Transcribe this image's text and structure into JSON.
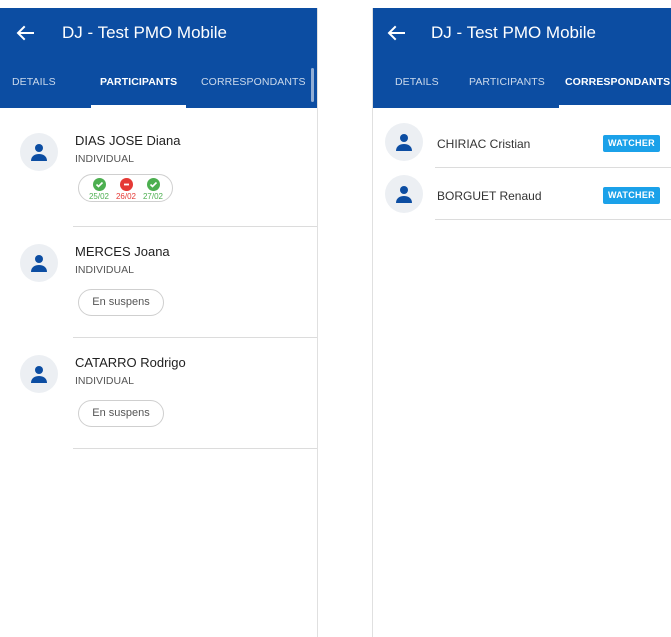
{
  "left_panel": {
    "title": "DJ - Test PMO Mobile",
    "tabs": [
      {
        "label": "DETAILS",
        "active": false
      },
      {
        "label": "PARTICIPANTS",
        "active": true
      },
      {
        "label": "CORRESPONDANTS",
        "active": false
      }
    ],
    "participants": [
      {
        "name": "DIAS JOSE Diana",
        "role": "INDIVIDUAL",
        "days": [
          {
            "date": "25/02",
            "status": "check"
          },
          {
            "date": "26/02",
            "status": "minus"
          },
          {
            "date": "27/02",
            "status": "check"
          }
        ]
      },
      {
        "name": "MERCES Joana",
        "role": "INDIVIDUAL",
        "status_label": "En suspens"
      },
      {
        "name": "CATARRO Rodrigo",
        "role": "INDIVIDUAL",
        "status_label": "En suspens"
      }
    ]
  },
  "right_panel": {
    "title": "DJ - Test PMO Mobile",
    "tabs": [
      {
        "label": "DETAILS",
        "active": false
      },
      {
        "label": "PARTICIPANTS",
        "active": false
      },
      {
        "label": "CORRESPONDANTS",
        "active": true
      }
    ],
    "correspondents": [
      {
        "name": "CHIRIAC Cristian",
        "badge": "WATCHER"
      },
      {
        "name": "BORGUET Renaud",
        "badge": "WATCHER"
      }
    ]
  },
  "colors": {
    "primary": "#0c4da2",
    "check_green": "#4caf50",
    "minus_red": "#e53935",
    "badge_blue": "#1ba1e9"
  },
  "icons": {
    "back": "arrow-left-icon",
    "avatar": "person-icon",
    "check": "check-circle-icon",
    "minus": "minus-circle-icon"
  }
}
